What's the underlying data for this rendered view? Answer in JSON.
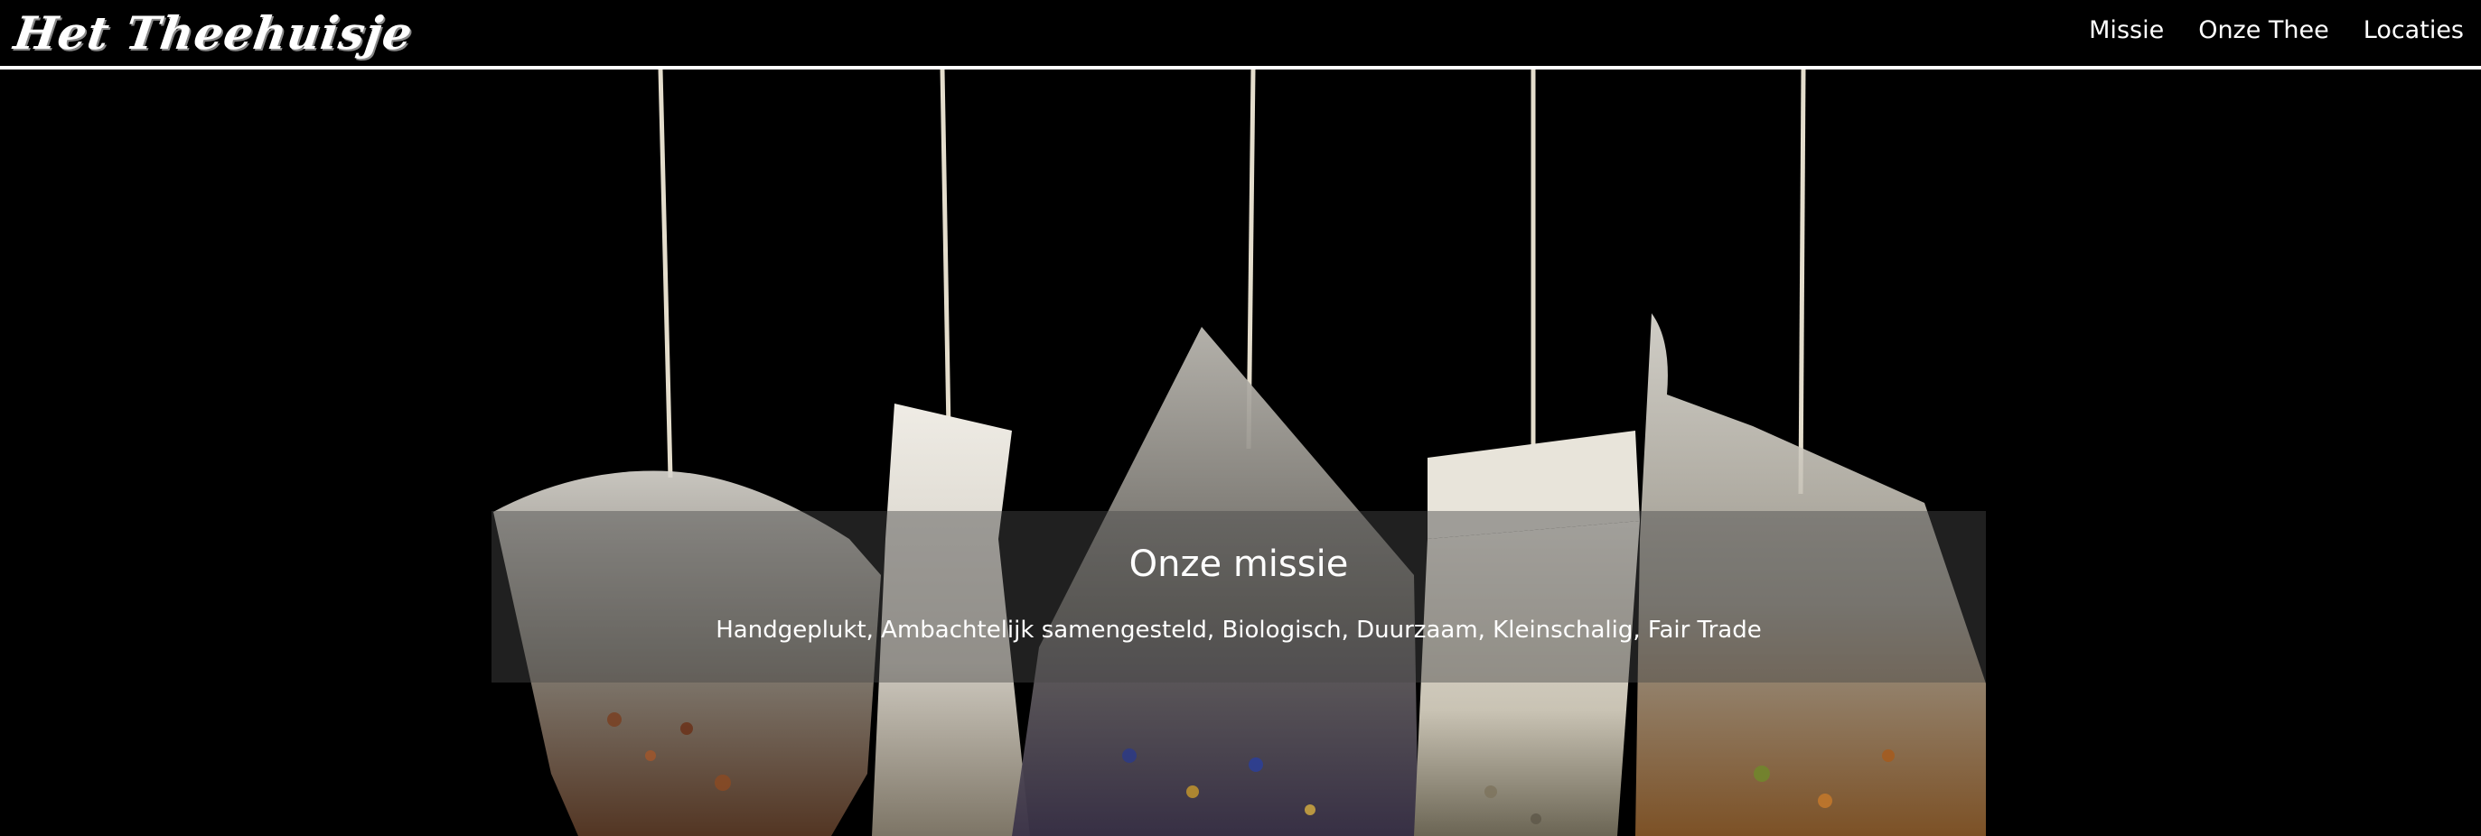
{
  "brand": {
    "logo_text": "Het Theehuisje"
  },
  "nav": {
    "items": [
      {
        "label": "Missie"
      },
      {
        "label": "Onze Thee"
      },
      {
        "label": "Locaties"
      }
    ]
  },
  "hero": {
    "title": "Onze missie",
    "subtitle": "Handgeplukt, Ambachtelijk samengesteld, Biologisch, Duurzaam, Kleinschalig, Fair Trade"
  },
  "colors": {
    "background": "#000000",
    "text": "#ffffff",
    "caption_overlay": "rgba(70,70,70,0.45)"
  }
}
